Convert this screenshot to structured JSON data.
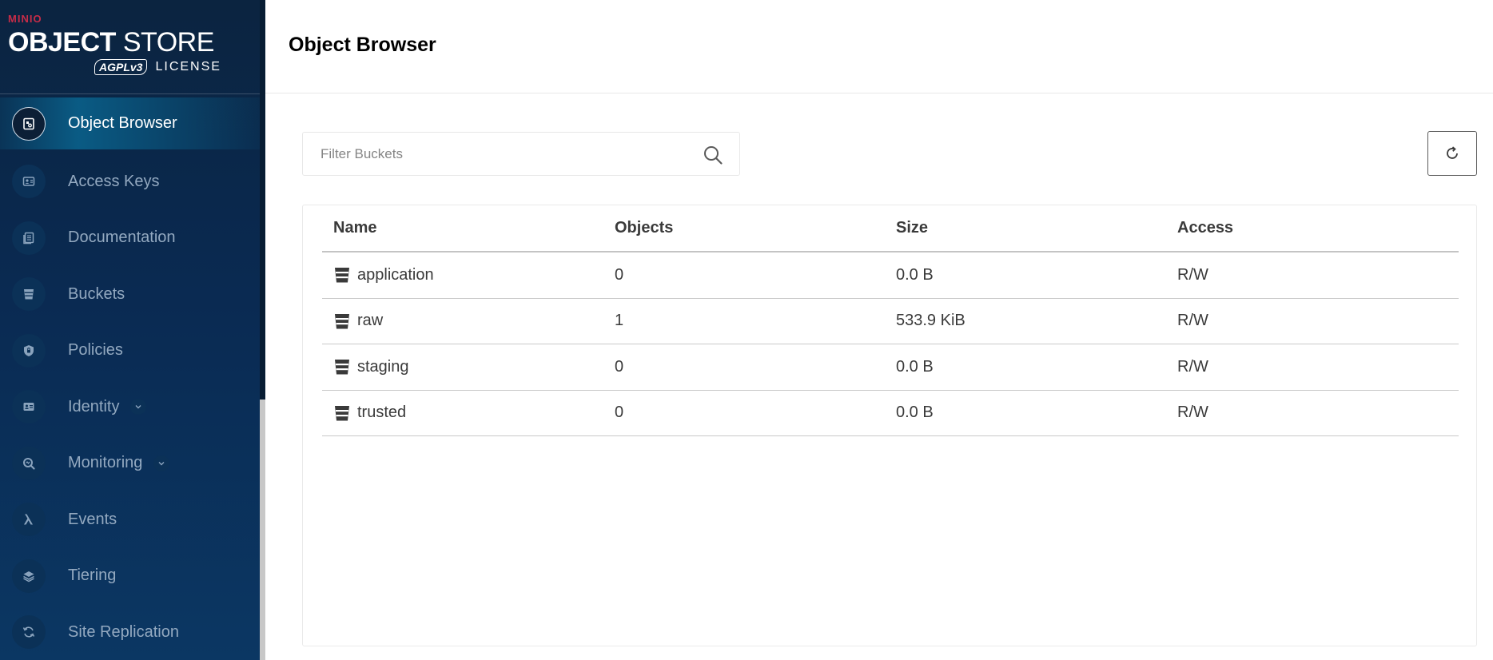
{
  "app": {
    "brand": "MINIO",
    "product_bold": "OBJECT",
    "product_light": "STORE",
    "badge": "AGPLv3",
    "license": "LICENSE"
  },
  "sidebar": {
    "items": [
      {
        "label": "Object Browser",
        "icon": "object-browser-icon",
        "active": true
      },
      {
        "label": "Access Keys",
        "icon": "access-keys-icon"
      },
      {
        "label": "Documentation",
        "icon": "documentation-icon"
      },
      {
        "label": "Buckets",
        "icon": "bucket-icon"
      },
      {
        "label": "Policies",
        "icon": "shield-icon"
      },
      {
        "label": "Identity",
        "icon": "id-card-icon",
        "expandable": true
      },
      {
        "label": "Monitoring",
        "icon": "magnifier-icon",
        "expandable": true
      },
      {
        "label": "Events",
        "icon": "lambda-icon"
      },
      {
        "label": "Tiering",
        "icon": "layers-icon"
      },
      {
        "label": "Site Replication",
        "icon": "sync-icon"
      }
    ]
  },
  "header": {
    "title": "Object Browser"
  },
  "filter": {
    "placeholder": "Filter Buckets",
    "value": ""
  },
  "table": {
    "columns": [
      "Name",
      "Objects",
      "Size",
      "Access"
    ],
    "rows": [
      {
        "name": "application",
        "objects": "0",
        "size": "0.0 B",
        "access": "R/W"
      },
      {
        "name": "raw",
        "objects": "1",
        "size": "533.9 KiB",
        "access": "R/W"
      },
      {
        "name": "staging",
        "objects": "0",
        "size": "0.0 B",
        "access": "R/W"
      },
      {
        "name": "trusted",
        "objects": "0",
        "size": "0.0 B",
        "access": "R/W"
      }
    ]
  },
  "colors": {
    "sidebar_bg": "#0a2a52",
    "active_item": "#0a5b84",
    "brand_red": "#c72c48"
  }
}
